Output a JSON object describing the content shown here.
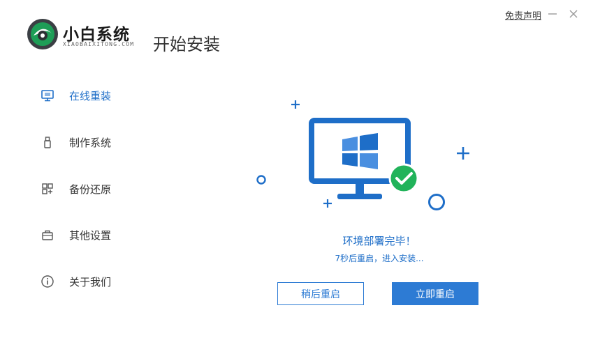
{
  "brand": {
    "name": "小白系统",
    "subtitle": "XIAOBAIXITONG.COM"
  },
  "header": {
    "page_title": "开始安装",
    "disclaimer_label": "免责声明"
  },
  "sidebar": {
    "items": [
      {
        "label": "在线重装",
        "icon": "monitor-icon",
        "active": true
      },
      {
        "label": "制作系统",
        "icon": "usb-drive-icon",
        "active": false
      },
      {
        "label": "备份还原",
        "icon": "backup-grid-icon",
        "active": false
      },
      {
        "label": "其他设置",
        "icon": "briefcase-icon",
        "active": false
      },
      {
        "label": "关于我们",
        "icon": "info-icon",
        "active": false
      }
    ]
  },
  "main": {
    "status_title": "环境部署完毕！",
    "status_detail": "7秒后重启，进入安装...",
    "later_button": "稍后重启",
    "restart_button": "立即重启"
  },
  "colors": {
    "accent": "#2d7bd4",
    "success": "#21b35a",
    "text": "#333333"
  }
}
